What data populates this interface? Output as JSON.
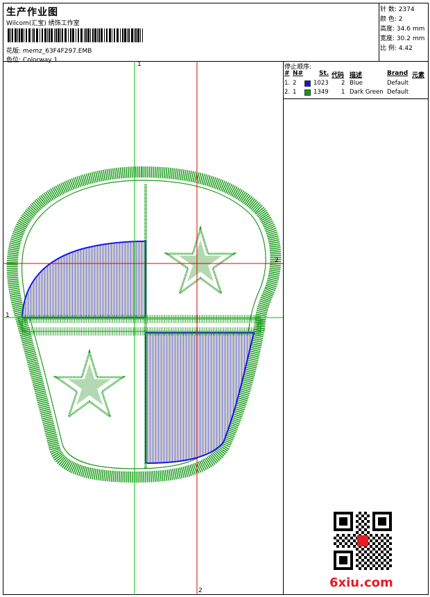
{
  "header": {
    "title": "生产作业图",
    "studio": "Wilcom(汇宝) 绣饰工作室",
    "design_label": "花版:",
    "design_value": "memz_63F4F297.EMB",
    "colorway_label": "色位:",
    "colorway_value": "Colorway 1"
  },
  "stats": [
    {
      "label": "针 数:",
      "value": "2374"
    },
    {
      "label": "颜 色:",
      "value": "2"
    },
    {
      "label": "高度:",
      "value": "34.6 mm"
    },
    {
      "label": "宽度:",
      "value": "30.2 mm"
    },
    {
      "label": "比 例:",
      "value": "4.42"
    }
  ],
  "stop_sequence": {
    "title": "停止顺序:",
    "headers": {
      "num": "#",
      "n": "N#",
      "st": "St.",
      "code": "代码",
      "desc": "描述",
      "brand": "Brand",
      "element": "元素"
    },
    "rows": [
      {
        "num": "1.",
        "n": "2",
        "color": "#1515e6",
        "st": "1023",
        "code": "2",
        "desc": "Blue",
        "brand": "Default"
      },
      {
        "num": "2.",
        "n": "1",
        "color": "#1a9a1a",
        "st": "1349",
        "code": "1",
        "desc": "Dark Green",
        "brand": "Default"
      }
    ]
  },
  "axes": {
    "green_top": "1",
    "green_left": "1",
    "red_right": "2",
    "red_bottom": "2"
  },
  "watermark": {
    "text": "6xiu.com"
  },
  "colors": {
    "green": "#1a9a1a",
    "blue": "#1515e6",
    "red_line": "#e00000",
    "green_line": "#00c000"
  }
}
